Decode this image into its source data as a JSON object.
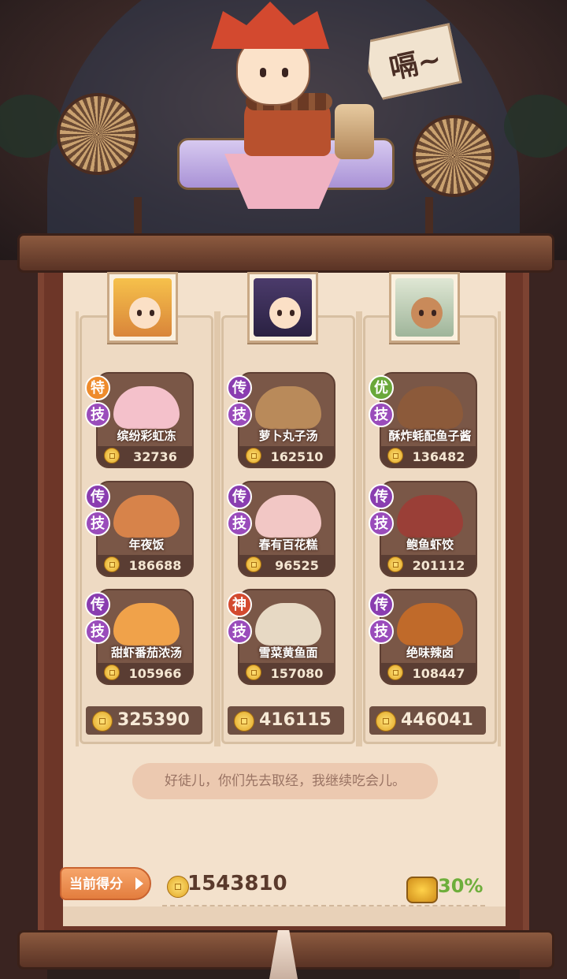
{
  "speech": "嗝~",
  "columns": [
    {
      "dishes": [
        {
          "rank": "特",
          "rank_color": "#ee8b2c",
          "skill": "技",
          "name": "缤纷彩虹冻",
          "score": "32736",
          "dish_color": "#f4c1cb"
        },
        {
          "rank": "传",
          "rank_color": "#8a3db0",
          "skill": "技",
          "name": "年夜饭",
          "score": "186688",
          "dish_color": "#d7834a"
        },
        {
          "rank": "传",
          "rank_color": "#8a3db0",
          "skill": "技",
          "name": "甜虾番茄浓汤",
          "score": "105966",
          "dish_color": "#f0a24a"
        }
      ],
      "total": "325390"
    },
    {
      "dishes": [
        {
          "rank": "传",
          "rank_color": "#8a3db0",
          "skill": "技",
          "name": "萝卜丸子汤",
          "score": "162510",
          "dish_color": "#b98a5a"
        },
        {
          "rank": "传",
          "rank_color": "#8a3db0",
          "skill": "技",
          "name": "春有百花糕",
          "score": "96525",
          "dish_color": "#f2c7c5"
        },
        {
          "rank": "神",
          "rank_color": "#d34a2f",
          "skill": "技",
          "name": "雪菜黄鱼面",
          "score": "157080",
          "dish_color": "#e7d9c4"
        }
      ],
      "total": "416115"
    },
    {
      "dishes": [
        {
          "rank": "优",
          "rank_color": "#6aa83a",
          "skill": "技",
          "name": "酥炸蚝配鱼子酱",
          "score": "136482",
          "dish_color": "#8c5a3a"
        },
        {
          "rank": "传",
          "rank_color": "#8a3db0",
          "skill": "技",
          "name": "鲍鱼虾饺",
          "score": "201112",
          "dish_color": "#9a3f37"
        },
        {
          "rank": "传",
          "rank_color": "#8a3db0",
          "skill": "技",
          "name": "绝味辣卤",
          "score": "108447",
          "dish_color": "#c06a2a"
        }
      ],
      "total": "446041"
    }
  ],
  "dialogue": "好徒儿，你们先去取经，我继续吃会儿。",
  "score_label": "当前得分",
  "final_score": "1543810",
  "bonus": "30%"
}
